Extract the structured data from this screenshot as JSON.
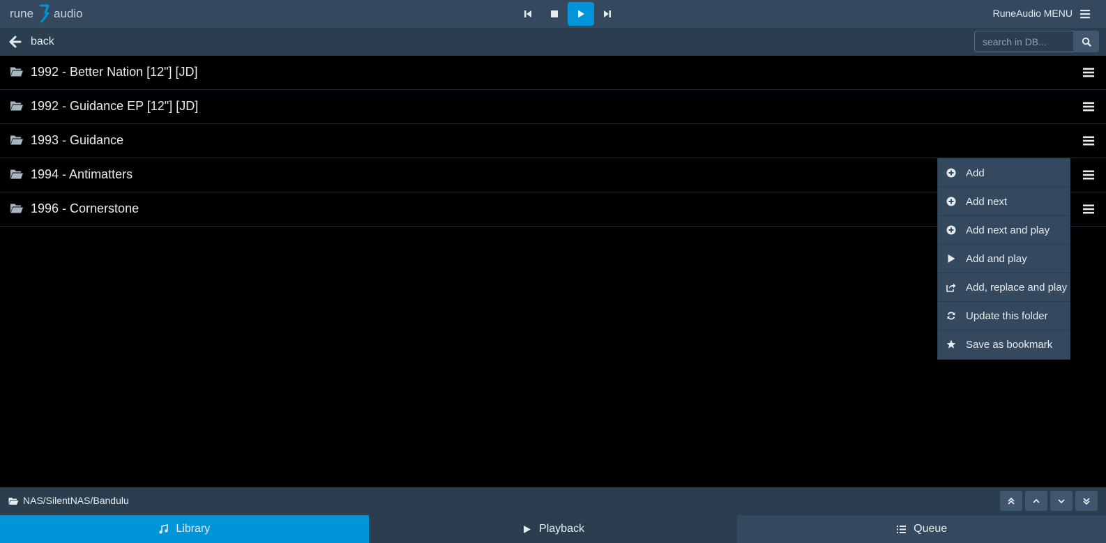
{
  "app": {
    "logo_left": "rune",
    "logo_right": "audio",
    "menu_label": "RuneAudio MENU"
  },
  "transport": {
    "icons": [
      "previous-icon",
      "stop-icon",
      "play-icon",
      "next-icon"
    ],
    "active": "play"
  },
  "nav": {
    "back_label": "back",
    "search_placeholder": "search in DB..."
  },
  "folders": [
    {
      "title": "1992 - Better Nation [12\"] [JD]"
    },
    {
      "title": "1992 - Guidance EP [12\"] [JD]"
    },
    {
      "title": "1993 - Guidance"
    },
    {
      "title": "1994 - Antimatters"
    },
    {
      "title": "1996 - Cornerstone"
    }
  ],
  "context_menu": {
    "items": [
      {
        "label": "Add",
        "icon": "plus-circle-icon"
      },
      {
        "label": "Add next",
        "icon": "plus-circle-icon"
      },
      {
        "label": "Add next and play",
        "icon": "plus-circle-icon"
      },
      {
        "label": "Add and play",
        "icon": "play-icon"
      },
      {
        "label": "Add, replace and play",
        "icon": "share-icon"
      },
      {
        "label": "Update this folder",
        "icon": "refresh-icon"
      },
      {
        "label": "Save as bookmark",
        "icon": "star-icon"
      }
    ]
  },
  "footer": {
    "path": "NAS/SilentNAS/Bandulu"
  },
  "tabs": [
    {
      "label": "Library",
      "icon": "music-icon",
      "active": true
    },
    {
      "label": "Playback",
      "icon": "play-icon",
      "active": false
    },
    {
      "label": "Queue",
      "icon": "list-icon",
      "active": false
    }
  ],
  "colors": {
    "accent": "#0095d8",
    "bar": "#34495e",
    "bar_dark": "#2b3e50",
    "background": "#000000"
  }
}
